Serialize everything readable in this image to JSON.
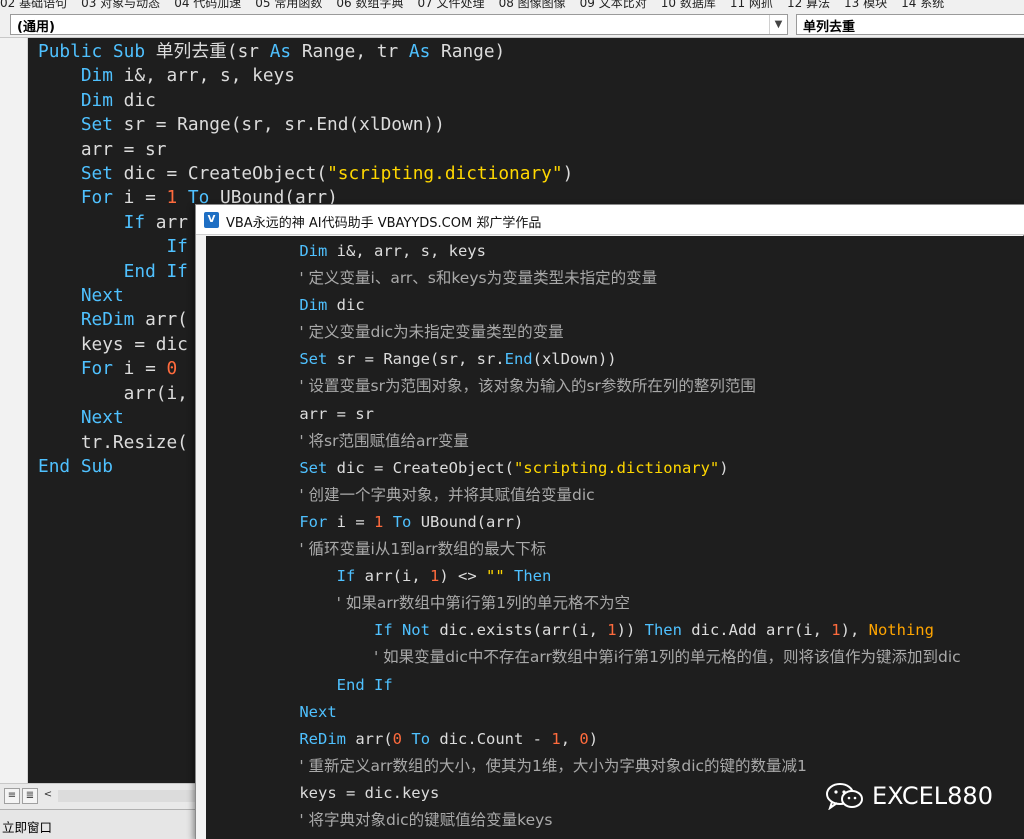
{
  "tabs": [
    "02 基础语句",
    "03 对象与动态",
    "04 代码加速",
    "05 常用函数",
    "06 数组字典",
    "07 文件处理",
    "08 图像图像",
    "09 文本比对",
    "10 数据库",
    "11 网抓",
    "12 算法",
    "13 模块",
    "14 系统"
  ],
  "dropdowns": {
    "general": "(通用)",
    "procedure": "单列去重"
  },
  "editor_lines": [
    [
      [
        "k",
        "Public Sub"
      ],
      [
        "n",
        " 单列去重(sr "
      ],
      [
        "k",
        "As"
      ],
      [
        "n",
        " Range, tr "
      ],
      [
        "k",
        "As"
      ],
      [
        "n",
        " Range)"
      ]
    ],
    [
      [
        "n",
        "    "
      ],
      [
        "k",
        "Dim"
      ],
      [
        "n",
        " i&, arr, s, keys"
      ]
    ],
    [
      [
        "n",
        "    "
      ],
      [
        "k",
        "Dim"
      ],
      [
        "n",
        " dic"
      ]
    ],
    [
      [
        "n",
        "    "
      ],
      [
        "k",
        "Set"
      ],
      [
        "n",
        " sr = Range(sr, sr.End(xlDown))"
      ]
    ],
    [
      [
        "n",
        "    arr = sr"
      ]
    ],
    [
      [
        "n",
        "    "
      ],
      [
        "k",
        "Set"
      ],
      [
        "n",
        " dic = CreateObject("
      ],
      [
        "s",
        "\"scripting.dictionary\""
      ],
      [
        "n",
        ")"
      ]
    ],
    [
      [
        "n",
        "    "
      ],
      [
        "k",
        "For"
      ],
      [
        "n",
        " i = "
      ],
      [
        "num",
        "1"
      ],
      [
        "n",
        " "
      ],
      [
        "k",
        "To"
      ],
      [
        "n",
        " UBound(arr)"
      ]
    ],
    [
      [
        "n",
        "        "
      ],
      [
        "k",
        "If"
      ],
      [
        "n",
        " arr"
      ]
    ],
    [
      [
        "n",
        "            "
      ],
      [
        "k",
        "If"
      ]
    ],
    [
      [
        "n",
        "        "
      ],
      [
        "k",
        "End If"
      ]
    ],
    [
      [
        "n",
        "    "
      ],
      [
        "k",
        "Next"
      ]
    ],
    [
      [
        "n",
        "    "
      ],
      [
        "k",
        "ReDim"
      ],
      [
        "n",
        " arr("
      ]
    ],
    [
      [
        "n",
        "    keys = dic"
      ]
    ],
    [
      [
        "n",
        "    "
      ],
      [
        "k",
        "For"
      ],
      [
        "n",
        " i = "
      ],
      [
        "num",
        "0"
      ]
    ],
    [
      [
        "n",
        "        arr(i,"
      ]
    ],
    [
      [
        "n",
        "    "
      ],
      [
        "k",
        "Next"
      ]
    ],
    [
      [
        "n",
        "    tr.Resize("
      ]
    ],
    [
      [
        "k",
        "End Sub"
      ]
    ]
  ],
  "popup": {
    "title": "VBA永远的神 AI代码助手 VBAYYDS.COM 郑广学作品",
    "lines": [
      [
        [
          "n",
          "          "
        ],
        [
          "pk",
          "Dim"
        ],
        [
          "n",
          " i&, arr, s, keys"
        ]
      ],
      [
        [
          "n",
          "          "
        ],
        [
          "cm",
          "' 定义变量i、arr、s和keys为变量类型未指定的变量"
        ]
      ],
      [
        [
          "n",
          "          "
        ],
        [
          "pk",
          "Dim"
        ],
        [
          "n",
          " dic"
        ]
      ],
      [
        [
          "n",
          "          "
        ],
        [
          "cm",
          "' 定义变量dic为未指定变量类型的变量"
        ]
      ],
      [
        [
          "n",
          "          "
        ],
        [
          "pk",
          "Set"
        ],
        [
          "n",
          " sr = Range(sr, sr."
        ],
        [
          "pk",
          "End"
        ],
        [
          "n",
          "(xlDown))"
        ]
      ],
      [
        [
          "n",
          "          "
        ],
        [
          "cm",
          "' 设置变量sr为范围对象，该对象为输入的sr参数所在列的整列范围"
        ]
      ],
      [
        [
          "n",
          "          arr = sr"
        ]
      ],
      [
        [
          "n",
          "          "
        ],
        [
          "cm",
          "' 将sr范围赋值给arr变量"
        ]
      ],
      [
        [
          "n",
          "          "
        ],
        [
          "pk",
          "Set"
        ],
        [
          "n",
          " dic = CreateObject("
        ],
        [
          "ps",
          "\"scripting.dictionary\""
        ],
        [
          "n",
          ")"
        ]
      ],
      [
        [
          "n",
          "          "
        ],
        [
          "cm",
          "' 创建一个字典对象，并将其赋值给变量dic"
        ]
      ],
      [
        [
          "n",
          "          "
        ],
        [
          "pk",
          "For"
        ],
        [
          "n",
          " i = "
        ],
        [
          "pnum",
          "1"
        ],
        [
          "n",
          " "
        ],
        [
          "pk",
          "To"
        ],
        [
          "n",
          " UBound(arr)"
        ]
      ],
      [
        [
          "n",
          "          "
        ],
        [
          "cm",
          "' 循环变量i从1到arr数组的最大下标"
        ]
      ],
      [
        [
          "n",
          "              "
        ],
        [
          "pk",
          "If"
        ],
        [
          "n",
          " arr(i, "
        ],
        [
          "pnum",
          "1"
        ],
        [
          "n",
          ") <> "
        ],
        [
          "ps",
          "\"\""
        ],
        [
          "n",
          " "
        ],
        [
          "pk",
          "Then"
        ]
      ],
      [
        [
          "n",
          "              "
        ],
        [
          "cm",
          "' 如果arr数组中第i行第1列的单元格不为空"
        ]
      ],
      [
        [
          "n",
          "                  "
        ],
        [
          "pk",
          "If Not"
        ],
        [
          "n",
          " dic.exists(arr(i, "
        ],
        [
          "pnum",
          "1"
        ],
        [
          "n",
          ")) "
        ],
        [
          "pk",
          "Then"
        ],
        [
          "n",
          " dic.Add arr(i, "
        ],
        [
          "pnum",
          "1"
        ],
        [
          "n",
          "), "
        ],
        [
          "pnot",
          "Nothing"
        ]
      ],
      [
        [
          "n",
          "                  "
        ],
        [
          "cm",
          "' 如果变量dic中不存在arr数组中第i行第1列的单元格的值，则将该值作为键添加到dic"
        ]
      ],
      [
        [
          "n",
          "              "
        ],
        [
          "pk",
          "End If"
        ]
      ],
      [
        [
          "n",
          "          "
        ],
        [
          "pk",
          "Next"
        ]
      ],
      [
        [
          "n",
          "          "
        ],
        [
          "pk",
          "ReDim"
        ],
        [
          "n",
          " arr("
        ],
        [
          "pnum",
          "0"
        ],
        [
          "n",
          " "
        ],
        [
          "pk",
          "To"
        ],
        [
          "n",
          " dic.Count - "
        ],
        [
          "pnum",
          "1"
        ],
        [
          "n",
          ", "
        ],
        [
          "pnum",
          "0"
        ],
        [
          "n",
          ")"
        ]
      ],
      [
        [
          "n",
          "          "
        ],
        [
          "cm",
          "' 重新定义arr数组的大小，使其为1维，大小为字典对象dic的键的数量减1"
        ]
      ],
      [
        [
          "n",
          "          keys = dic.keys"
        ]
      ],
      [
        [
          "n",
          "          "
        ],
        [
          "cm",
          "' 将字典对象dic的键赋值给变量keys"
        ]
      ]
    ]
  },
  "immediate_window_label": "立即窗口",
  "watermark": "EXCEL880"
}
